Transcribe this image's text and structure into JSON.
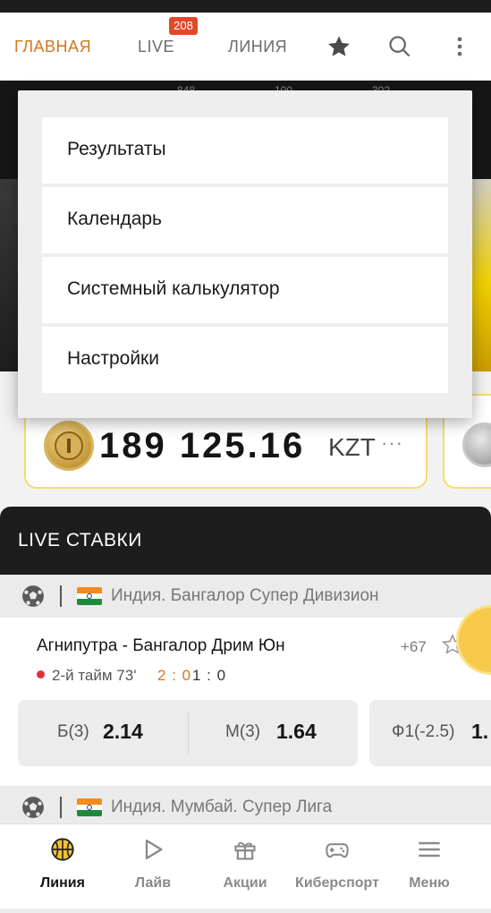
{
  "header": {
    "tabs": [
      {
        "label": "ГЛАВНАЯ",
        "active": true
      },
      {
        "label": "LIVE",
        "badge": "208",
        "active": false
      },
      {
        "label": "ЛИНИЯ",
        "active": false
      }
    ],
    "icons": [
      "star-icon",
      "search-icon",
      "more-vertical-icon"
    ]
  },
  "banner": {
    "numbers": [
      "848",
      "100",
      "302"
    ]
  },
  "dropdown": {
    "items": [
      {
        "label": "Результаты"
      },
      {
        "label": "Календарь"
      },
      {
        "label": "Системный калькулятор"
      },
      {
        "label": "Настройки"
      }
    ]
  },
  "balance": {
    "amount": "189 125.16",
    "currency": "KZT",
    "more": "···"
  },
  "live": {
    "title": "LIVE СТАВКИ",
    "leagues": [
      {
        "name": "Индия. Бангалор Супер Дивизион",
        "sport_icon": "soccer-ball-icon",
        "flag": "india-flag-icon"
      },
      {
        "name": "Индия. Мумбай. Супер Лига",
        "sport_icon": "soccer-ball-icon",
        "flag": "india-flag-icon"
      }
    ],
    "match": {
      "teams": "Агнипутра - Бангалор Дрим Юн",
      "more_markets": "+67",
      "period": "2-й тайм 73'",
      "score": "2 : 0",
      "half_score": "1 : 0",
      "odds": [
        {
          "label": "Б(3)",
          "value": "2.14"
        },
        {
          "label": "М(3)",
          "value": "1.64"
        },
        {
          "label": "Ф1(-2.5)",
          "value": "1."
        }
      ]
    }
  },
  "bottom_nav": [
    {
      "label": "Линия",
      "icon": "basketball-icon",
      "active": true
    },
    {
      "label": "Лайв",
      "icon": "play-icon",
      "active": false
    },
    {
      "label": "Акции",
      "icon": "gift-icon",
      "active": false
    },
    {
      "label": "Киберспорт",
      "icon": "gamepad-icon",
      "active": false
    },
    {
      "label": "Меню",
      "icon": "menu-icon",
      "active": false
    }
  ],
  "colors": {
    "accent": "#d4761c",
    "badge": "#e04a2a",
    "card_border": "#f6dd6a",
    "live_dot": "#e0303a"
  }
}
